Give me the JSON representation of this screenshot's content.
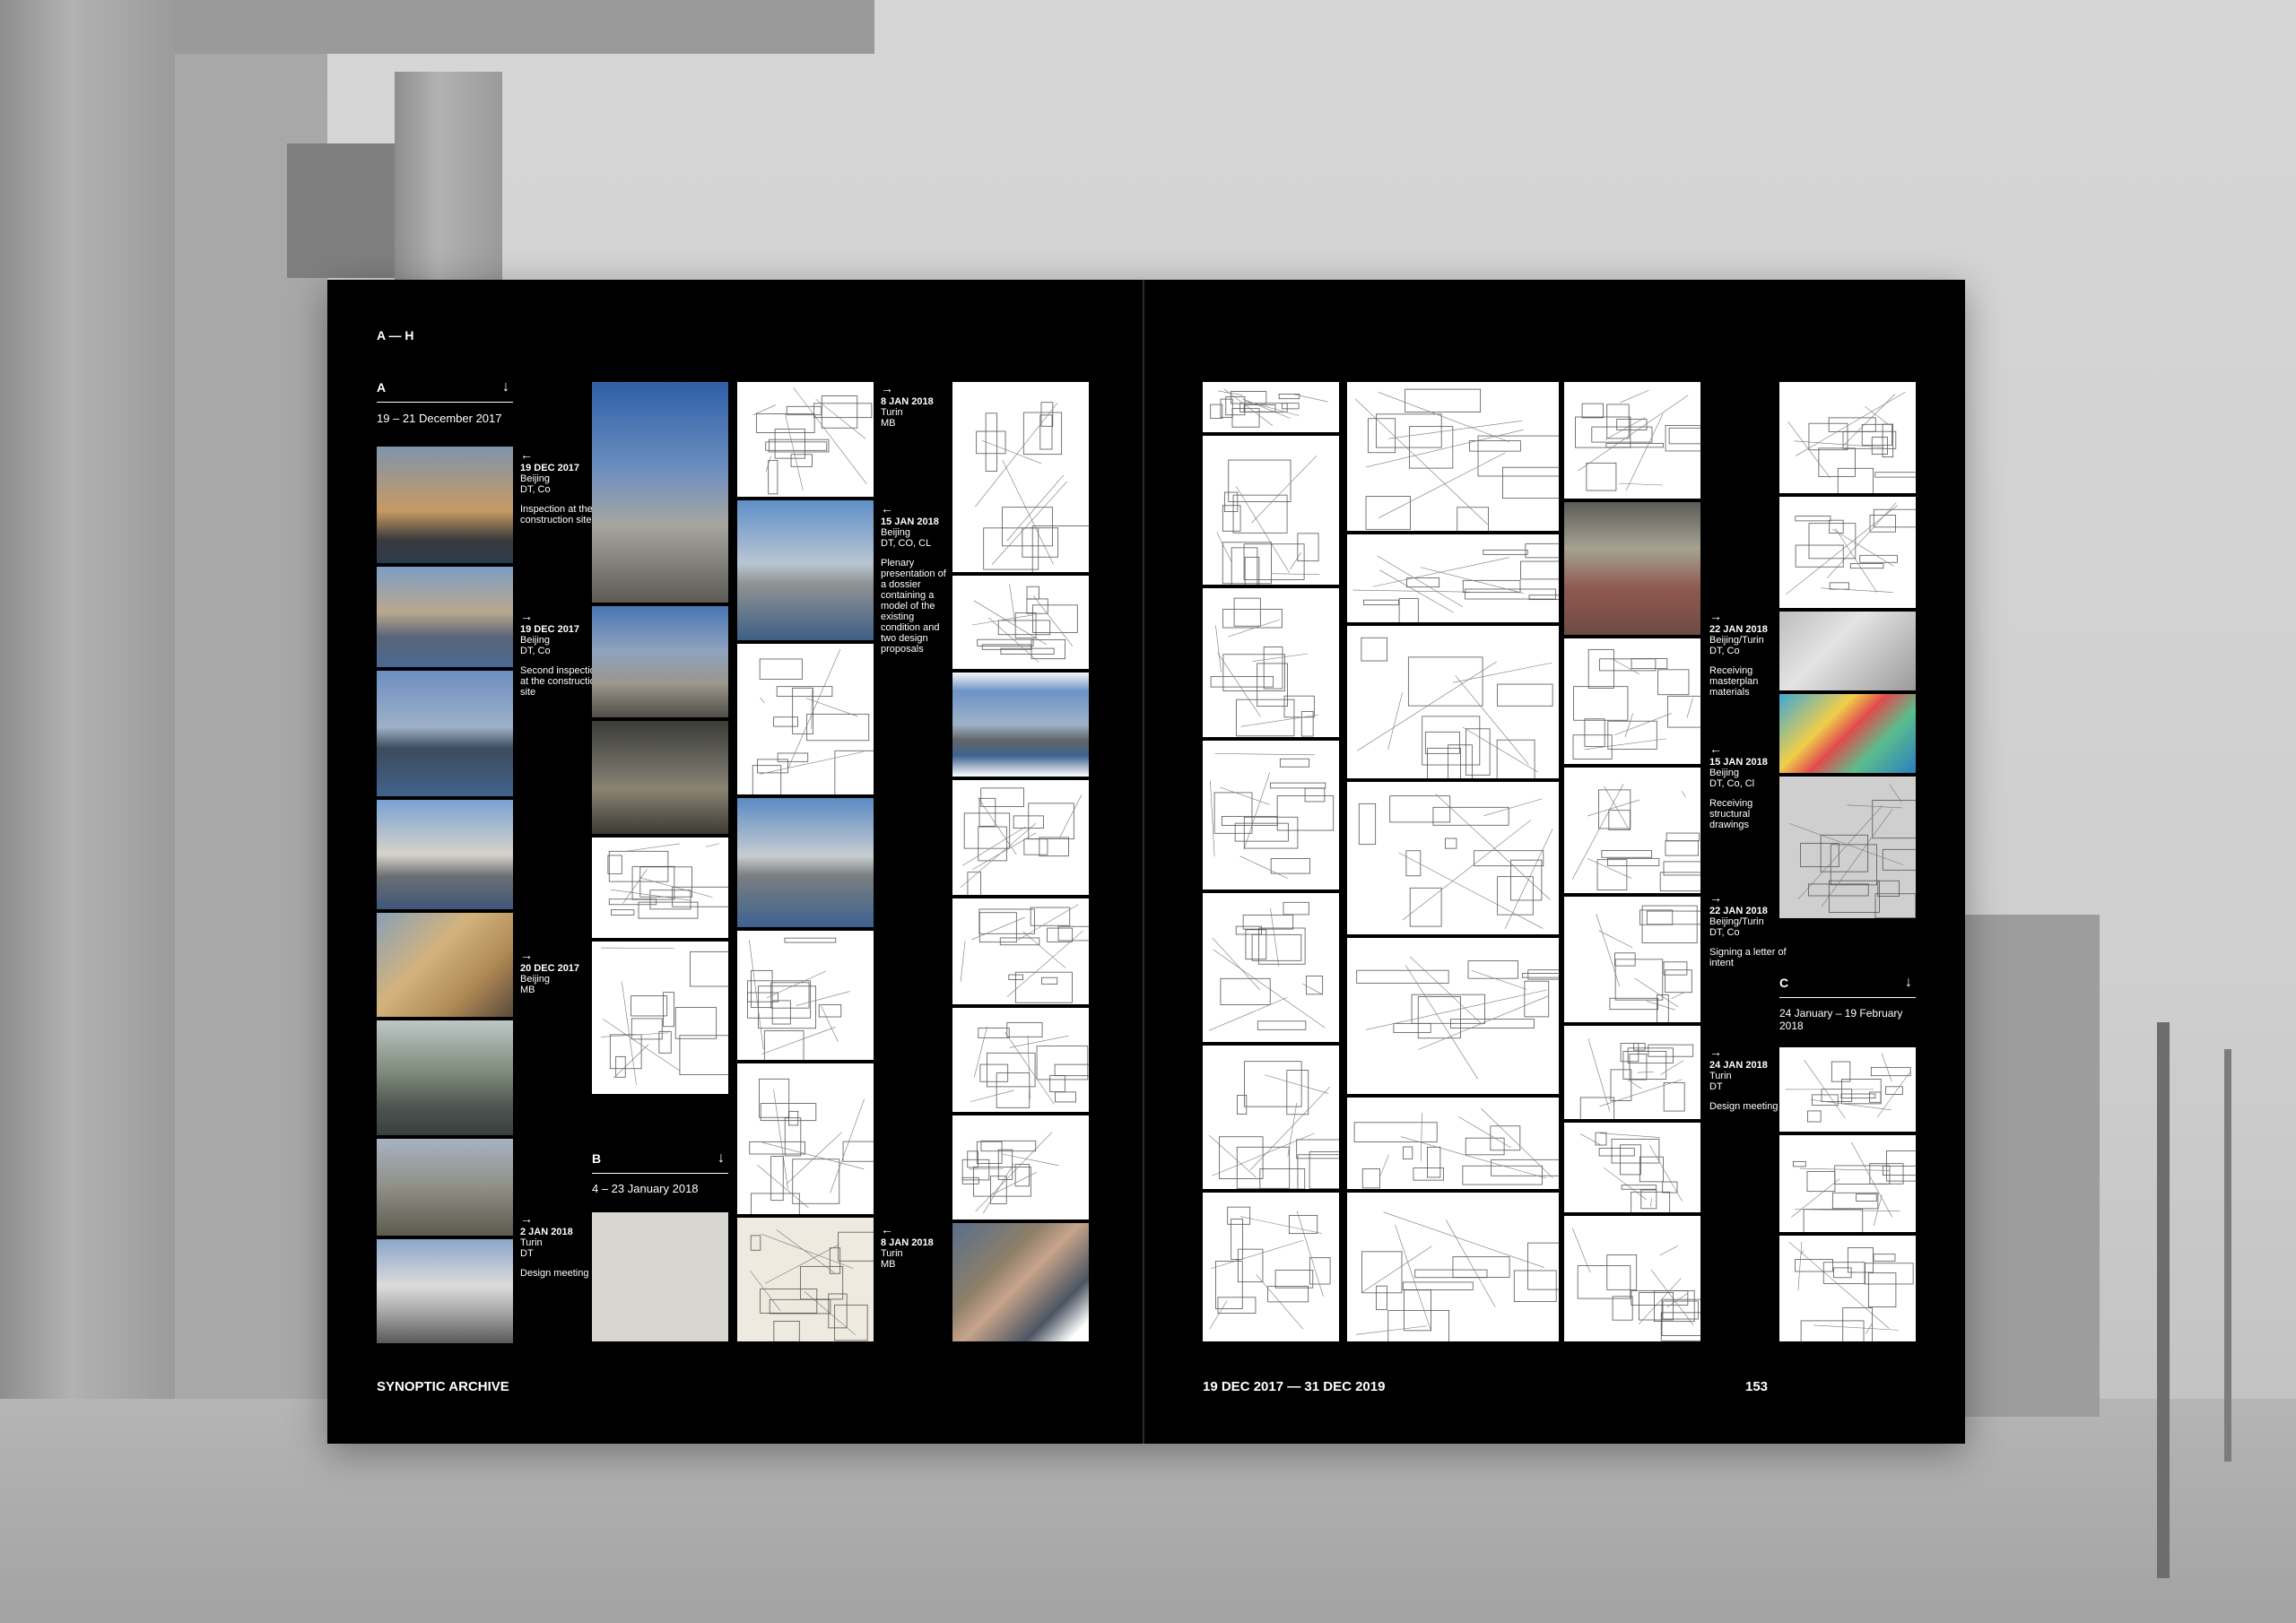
{
  "spread": {
    "index_label": "A — H",
    "footer_left": "SYNOPTIC ARCHIVE",
    "footer_right_dates": "19 DEC 2017 — 31 DEC 2019",
    "page_number": "153"
  },
  "sections": {
    "a": {
      "letter": "A",
      "dates": "19 – 21 December 2017"
    },
    "b": {
      "letter": "B",
      "dates": "4 – 23 January 2018"
    },
    "c": {
      "letter": "C",
      "dates": "24 January – 19 February 2018"
    }
  },
  "events": {
    "e1": {
      "date": "19 DEC 2017",
      "place": "Beijing",
      "people": "DT, Co",
      "desc": "Inspection at the construction site"
    },
    "e2": {
      "date": "19 DEC 2017",
      "place": "Beijing",
      "people": "DT, Co",
      "desc": "Second inspection at the construction site"
    },
    "e3": {
      "date": "20 DEC 2017",
      "place": "Beijing",
      "people": "MB",
      "desc": ""
    },
    "e4": {
      "date": "2 JAN 2018",
      "place": "Turin",
      "people": "DT",
      "desc": "Design meeting"
    },
    "e5": {
      "date": "8 JAN 2018",
      "place": "Turin",
      "people": "MB",
      "desc": ""
    },
    "e6": {
      "date": "15 JAN 2018",
      "place": "Beijing",
      "people": "DT, CO, CL",
      "desc": "Plenary presentation of a dossier containing a model of the existing condition and two design proposals"
    },
    "e7": {
      "date": "8 JAN 2018",
      "place": "Turin",
      "people": "MB",
      "desc": ""
    },
    "e8": {
      "date": "22 JAN 2018",
      "place": "Beijing/Turin",
      "people": "DT, Co",
      "desc": "Receiving masterplan materials"
    },
    "e9": {
      "date": "15 JAN 2018",
      "place": "Beijing",
      "people": "DT, Co, Cl",
      "desc": "Receiving structural drawings"
    },
    "e10": {
      "date": "22 JAN 2018",
      "place": "Beijing/Turin",
      "people": "DT, Co",
      "desc": "Signing a letter of intent"
    },
    "e11": {
      "date": "24 JAN 2018",
      "place": "Turin",
      "people": "DT",
      "desc": "Design meeting"
    }
  },
  "icons": {
    "arrow_right": "→",
    "arrow_left": "←",
    "arrow_down": "↓"
  }
}
